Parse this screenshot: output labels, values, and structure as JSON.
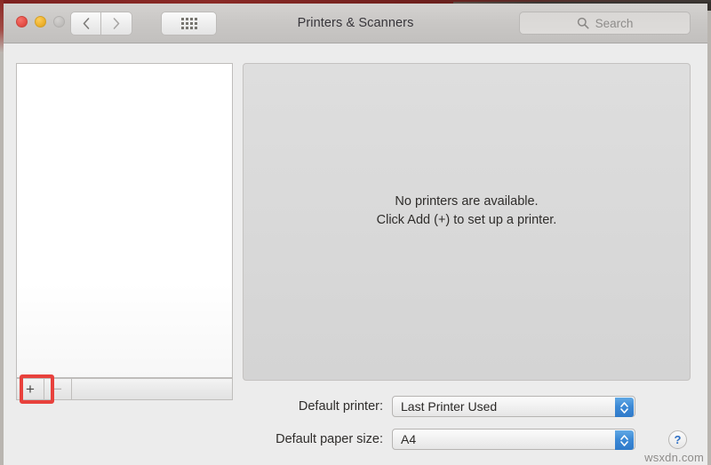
{
  "window": {
    "title": "Printers & Scanners",
    "traffic_lights": [
      {
        "name": "close",
        "color": "#e8524a"
      },
      {
        "name": "minimize",
        "color": "#f0b430"
      },
      {
        "name": "zoom",
        "color": "#c3c1bf"
      }
    ],
    "nav": {
      "back_label": "‹",
      "forward_label": "›",
      "grid_label": "show-all"
    },
    "search": {
      "placeholder": "Search",
      "icon": "search-icon"
    }
  },
  "sidebar": {
    "printers": [],
    "toolbar": {
      "add_label": "+",
      "remove_label": "−"
    }
  },
  "detail": {
    "empty_line1": "No printers are available.",
    "empty_line2": "Click Add (+) to set up a printer."
  },
  "preferences": [
    {
      "label": "Default printer:",
      "value": "Last Printer Used",
      "name": "default-printer"
    },
    {
      "label": "Default paper size:",
      "value": "A4",
      "name": "default-paper-size"
    }
  ],
  "help": {
    "label": "?"
  },
  "watermark": {
    "text": "wsxdn.com"
  },
  "annotation": {
    "target": "add-printer-button",
    "color": "#e8413c"
  },
  "colors": {
    "accent_blue": "#3d8ad6",
    "annotation_red": "#e8413c",
    "window_bg": "#ececec",
    "panel_bg": "#d9d9d9"
  }
}
